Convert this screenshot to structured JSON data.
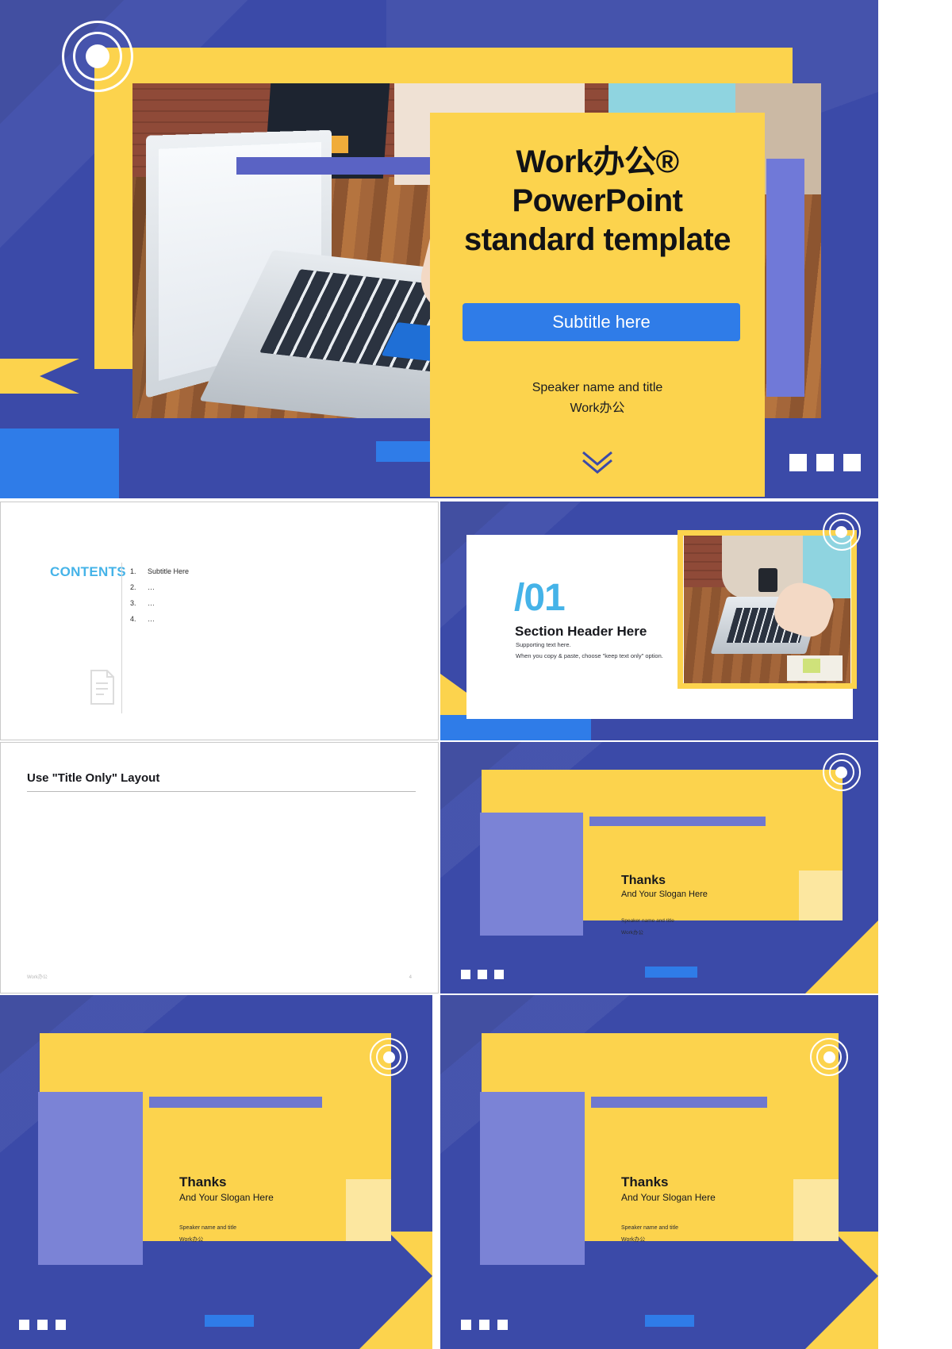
{
  "theme": {
    "blue": "#3b4aa8",
    "yellow": "#fcd34d",
    "accent_blue": "#2f7ce8",
    "light_blue": "#45b3e8",
    "lavender": "#7b83d6",
    "white": "#ffffff"
  },
  "slide1": {
    "title_line1": "Work办公®",
    "title_line2": "PowerPoint",
    "title_line3": "standard template",
    "subtitle_button": "Subtitle here",
    "speaker": "Speaker name and title",
    "organization": "Work办公",
    "chevron": "⌄",
    "dots": [
      "dot-1",
      "dot-2",
      "dot-3"
    ]
  },
  "slide2": {
    "label": "CONTENTS",
    "items": [
      {
        "num": "1.",
        "text": "Subtitle Here"
      },
      {
        "num": "2.",
        "text": "…"
      },
      {
        "num": "3.",
        "text": "…"
      },
      {
        "num": "4.",
        "text": "…"
      }
    ]
  },
  "slide3": {
    "number": "/01",
    "header": "Section Header Here",
    "support_line1": "Supporting text here.",
    "support_line2": "When you copy & paste, choose \"keep text only\" option.",
    "dots": [
      "dot-1",
      "dot-2",
      "dot-3"
    ]
  },
  "slide4": {
    "title": "Use \"Title Only\" Layout",
    "footer_left": "Work办公",
    "footer_right": "4"
  },
  "slide5": {
    "title": "Thanks",
    "slogan": "And Your Slogan Here",
    "speaker": "Speaker name and title",
    "organization": "Work办公",
    "dots": [
      "dot-1",
      "dot-2",
      "dot-3"
    ]
  },
  "slide6": {
    "title": "Thanks",
    "slogan": "And Your Slogan Here",
    "speaker": "Speaker name and title",
    "organization": "Work办公",
    "dots": [
      "dot-1",
      "dot-2",
      "dot-3"
    ]
  },
  "slide7": {
    "title": "Thanks",
    "slogan": "And Your Slogan Here",
    "speaker": "Speaker name and title",
    "organization": "Work办公",
    "dots": [
      "dot-1",
      "dot-2",
      "dot-3"
    ]
  }
}
